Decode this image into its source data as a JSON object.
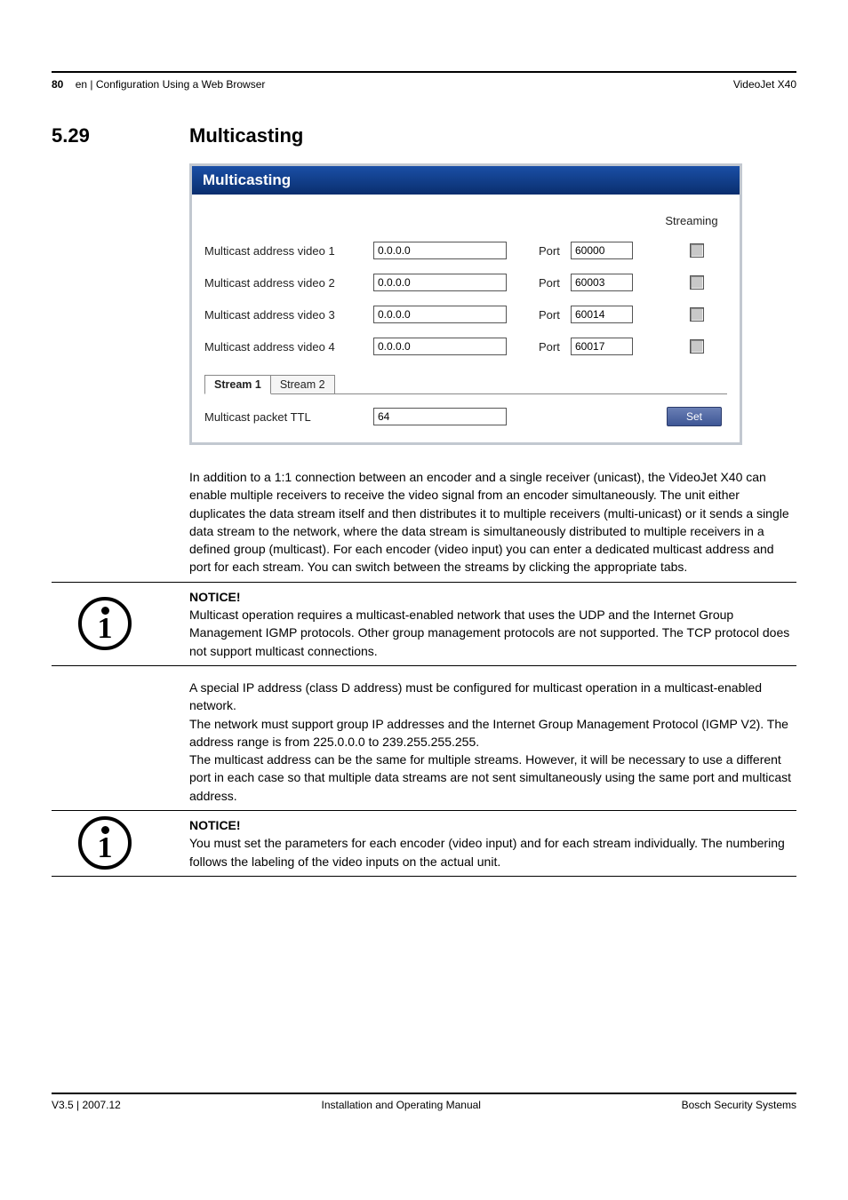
{
  "header": {
    "page_num": "80",
    "breadcrumb": "en | Configuration Using a Web Browser",
    "product": "VideoJet X40"
  },
  "section": {
    "number": "5.29",
    "title": "Multicasting"
  },
  "panel": {
    "title": "Multicasting",
    "streaming_col": "Streaming",
    "port_label": "Port",
    "rows": [
      {
        "label": "Multicast address video 1",
        "addr": "0.0.0.0",
        "port": "60000"
      },
      {
        "label": "Multicast address video 2",
        "addr": "0.0.0.0",
        "port": "60003"
      },
      {
        "label": "Multicast address video 3",
        "addr": "0.0.0.0",
        "port": "60014"
      },
      {
        "label": "Multicast address video 4",
        "addr": "0.0.0.0",
        "port": "60017"
      }
    ],
    "tabs": {
      "t1": "Stream 1",
      "t2": "Stream 2"
    },
    "ttl_label": "Multicast packet TTL",
    "ttl_value": "64",
    "set_label": "Set"
  },
  "para1": "In addition to a 1:1 connection between an encoder and a single receiver (unicast), the VideoJet X40 can enable multiple receivers to receive the video signal from an encoder simultaneously. The unit either duplicates the data stream itself and then distributes it to multiple receivers (multi-unicast) or it sends a single data stream to the network, where the data stream is simultaneously distributed to multiple receivers in a defined group (multicast). For each encoder (video input) you can enter a dedicated multicast address and port for each stream. You can switch between the streams by clicking the appropriate tabs.",
  "notice1": {
    "heading": "NOTICE!",
    "body": "Multicast operation requires a multicast-enabled network that uses the UDP and the Internet Group Management IGMP protocols. Other group management protocols are not supported. The TCP protocol does not support multicast connections."
  },
  "para2a": "A special IP address (class D address) must be configured for multicast operation in a multicast-enabled network.",
  "para2b": "The network must support group IP addresses and the Internet Group Management Protocol (IGMP V2). The address range is from 225.0.0.0 to 239.255.255.255.",
  "para2c": "The multicast address can be the same for multiple streams. However, it will be necessary to use a different port in each case so that multiple data streams are not sent simultaneously using the same port and multicast address.",
  "notice2": {
    "heading": "NOTICE!",
    "body": "You must set the parameters for each encoder (video input) and for each stream individually. The numbering follows the labeling of the video inputs on the actual unit."
  },
  "footer": {
    "left": "V3.5 | 2007.12",
    "center": "Installation and Operating Manual",
    "right": "Bosch Security Systems"
  }
}
